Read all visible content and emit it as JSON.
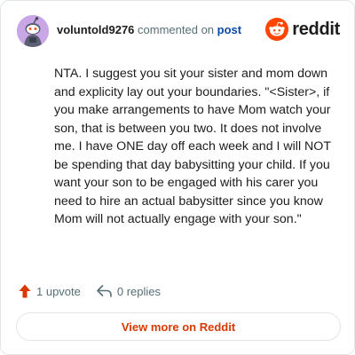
{
  "header": {
    "author": "voluntold9276",
    "action_text": "commented on",
    "post_link": "post",
    "brand": "reddit"
  },
  "comment": {
    "body": "NTA. I suggest you sit your sister and mom down and explicity lay out your boundaries. \"<Sister>, if you make arrangements to have Mom watch your son, that is between you two. It does not involve me. I have ONE day off each week and I will NOT be spending that day babysitting your child. If you want your son to be engaged with his carer you need to hire an actual babysitter since you know Mom will not actually engage with your son.\""
  },
  "actions": {
    "upvotes": "1 upvote",
    "replies": "0 replies"
  },
  "footer": {
    "view_more": "View more on Reddit"
  },
  "colors": {
    "brand_orange": "#ff4500",
    "upvote": "#d93900",
    "link_blue": "#0a49a8",
    "avatar_bg": "#c9a6e6"
  },
  "icons": {
    "avatar": "snoo-avatar-icon",
    "brand": "reddit-logo-icon",
    "upvote": "upvote-arrow-icon",
    "reply": "reply-arrow-icon"
  }
}
